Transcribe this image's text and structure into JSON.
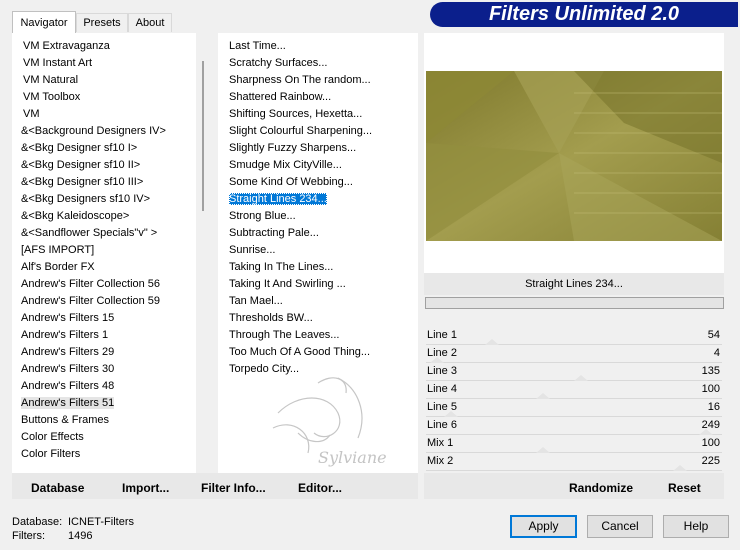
{
  "tabs": [
    "Navigator",
    "Presets",
    "About"
  ],
  "banner": "Filters Unlimited 2.0",
  "categories": [
    "VM Extravaganza",
    "VM Instant Art",
    "VM Natural",
    "VM Toolbox",
    "VM",
    "&<Background Designers IV>",
    "&<Bkg Designer sf10 I>",
    "&<Bkg Designer sf10 II>",
    "&<Bkg Designer sf10 III>",
    "&<Bkg Designers sf10 IV>",
    "&<Bkg Kaleidoscope>",
    "&<Sandflower Specials\"v\" >",
    "[AFS IMPORT]",
    "Alf's Border FX",
    "Andrew's Filter Collection 56",
    "Andrew's Filter Collection 59",
    "Andrew's Filters 15",
    "Andrew's Filters 1",
    "Andrew's Filters 29",
    "Andrew's Filters 30",
    "Andrew's Filters 48",
    "Andrew's Filters 51",
    "Buttons & Frames",
    "Color Effects",
    "Color Filters"
  ],
  "filters": [
    "Last Time...",
    "Scratchy Surfaces...",
    "Sharpness On The random...",
    "Shattered Rainbow...",
    "Shifting Sources, Hexetta...",
    "Slight Colourful Sharpening...",
    "Slightly Fuzzy Sharpens...",
    "Smudge Mix CityVille...",
    "Some Kind Of Webbing...",
    "Straight Lines 234...",
    "Strong Blue...",
    "Subtracting Pale...",
    "Sunrise...",
    "Taking In The Lines...",
    "Taking It And Swirling ...",
    "Tan Mael...",
    "Thresholds BW...",
    "Through The Leaves...",
    "Too Much Of A Good Thing...",
    "Torpedo City..."
  ],
  "selected_filter_title": "Straight Lines 234...",
  "watermark": "Sylviane",
  "params": [
    {
      "label": "Line 1",
      "value": "54"
    },
    {
      "label": "Line 2",
      "value": "4"
    },
    {
      "label": "Line 3",
      "value": "135"
    },
    {
      "label": "Line 4",
      "value": "100"
    },
    {
      "label": "Line 5",
      "value": "16"
    },
    {
      "label": "Line 6",
      "value": "249"
    },
    {
      "label": "Mix 1",
      "value": "100"
    },
    {
      "label": "Mix 2",
      "value": "225"
    }
  ],
  "bottom_buttons": {
    "database": "Database",
    "import": "Import...",
    "filter_info": "Filter Info...",
    "editor": "Editor...",
    "randomize": "Randomize",
    "reset": "Reset"
  },
  "dialog_buttons": {
    "apply": "Apply",
    "cancel": "Cancel",
    "help": "Help"
  },
  "status": {
    "db_label": "Database:",
    "db_value": "ICNET-Filters",
    "f_label": "Filters:",
    "f_value": "1496"
  },
  "colors": {
    "banner": "#0b1f8c",
    "preview_base": "#8f8a3a",
    "selection": "#0078d7"
  }
}
